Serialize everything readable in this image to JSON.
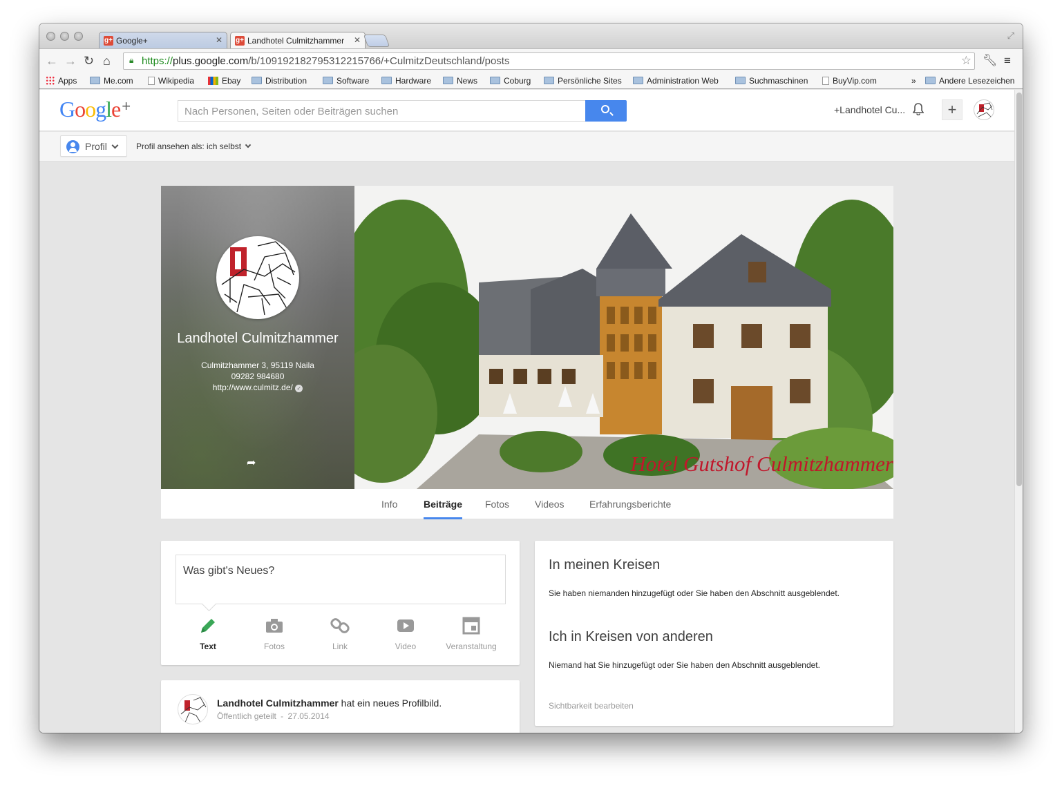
{
  "browser": {
    "tabs": [
      {
        "label": "Google+",
        "favicon": "g+"
      },
      {
        "label": "Landhotel Culmitzhammer",
        "favicon": "g+"
      }
    ],
    "url": {
      "scheme": "https://",
      "host": "plus.google.com",
      "path": "/b/109192182795312215766/+CulmitzDeutschland/posts"
    },
    "bookmarks": [
      {
        "label": "Apps",
        "icon": "apps-grid-icon"
      },
      {
        "label": "Me.com",
        "icon": "folder-icon"
      },
      {
        "label": "Wikipedia",
        "icon": "page-icon"
      },
      {
        "label": "Ebay",
        "icon": "ebay-icon"
      },
      {
        "label": "Distribution",
        "icon": "folder-icon"
      },
      {
        "label": "Software",
        "icon": "folder-icon"
      },
      {
        "label": "Hardware",
        "icon": "folder-icon"
      },
      {
        "label": "News",
        "icon": "folder-icon"
      },
      {
        "label": "Coburg",
        "icon": "folder-icon"
      },
      {
        "label": "Persönliche Sites",
        "icon": "folder-icon"
      },
      {
        "label": "Administration Web",
        "icon": "folder-icon"
      },
      {
        "label": "Suchmaschinen",
        "icon": "folder-icon"
      },
      {
        "label": "BuyVip.com",
        "icon": "page-icon"
      }
    ],
    "overflow_label": "»",
    "other_bookmarks": "Andere Lesezeichen"
  },
  "gplus": {
    "logo": {
      "text": "Google",
      "plus": "+"
    },
    "search_placeholder": "Nach Personen, Seiten oder Beiträgen suchen",
    "user_label": "+Landhotel Cu...",
    "profile_button": "Profil",
    "view_as": "Profil ansehen als: ich selbst"
  },
  "profile": {
    "name": "Landhotel Culmitzhammer",
    "address": "Culmitzhammer 3, 95119 Naila",
    "phone": "09282 984680",
    "website": "http://www.culmitz.de/",
    "cover_caption": "Hotel Gutshof Culmitzhammer"
  },
  "profile_tabs": [
    "Info",
    "Beiträge",
    "Fotos",
    "Videos",
    "Erfahrungsberichte"
  ],
  "active_tab": "Beiträge",
  "share_box": {
    "placeholder": "Was gibt's Neues?",
    "options": [
      {
        "label": "Text",
        "icon": "pencil-icon"
      },
      {
        "label": "Fotos",
        "icon": "camera-icon"
      },
      {
        "label": "Link",
        "icon": "link-icon"
      },
      {
        "label": "Video",
        "icon": "video-icon"
      },
      {
        "label": "Veranstaltung",
        "icon": "calendar-icon"
      }
    ]
  },
  "post": {
    "author": "Landhotel Culmitzhammer",
    "action": " hat ein neues Profilbild.",
    "visibility": "Öffentlich geteilt",
    "separator": "-",
    "date": "27.05.2014"
  },
  "circles": {
    "in_my_circles_title": "In meinen Kreisen",
    "in_my_circles_text": "Sie haben niemanden hinzugefügt oder Sie haben den Abschnitt ausgeblendet.",
    "in_others_title": "Ich in Kreisen von anderen",
    "in_others_text": "Niemand hat Sie hinzugefügt oder Sie haben den Abschnitt ausgeblendet.",
    "edit_link": "Sichtbarkeit bearbeiten"
  },
  "colors": {
    "accent": "#4787ed",
    "text_tab_green": "#3aa757",
    "brand_red": "#dd4b39"
  }
}
